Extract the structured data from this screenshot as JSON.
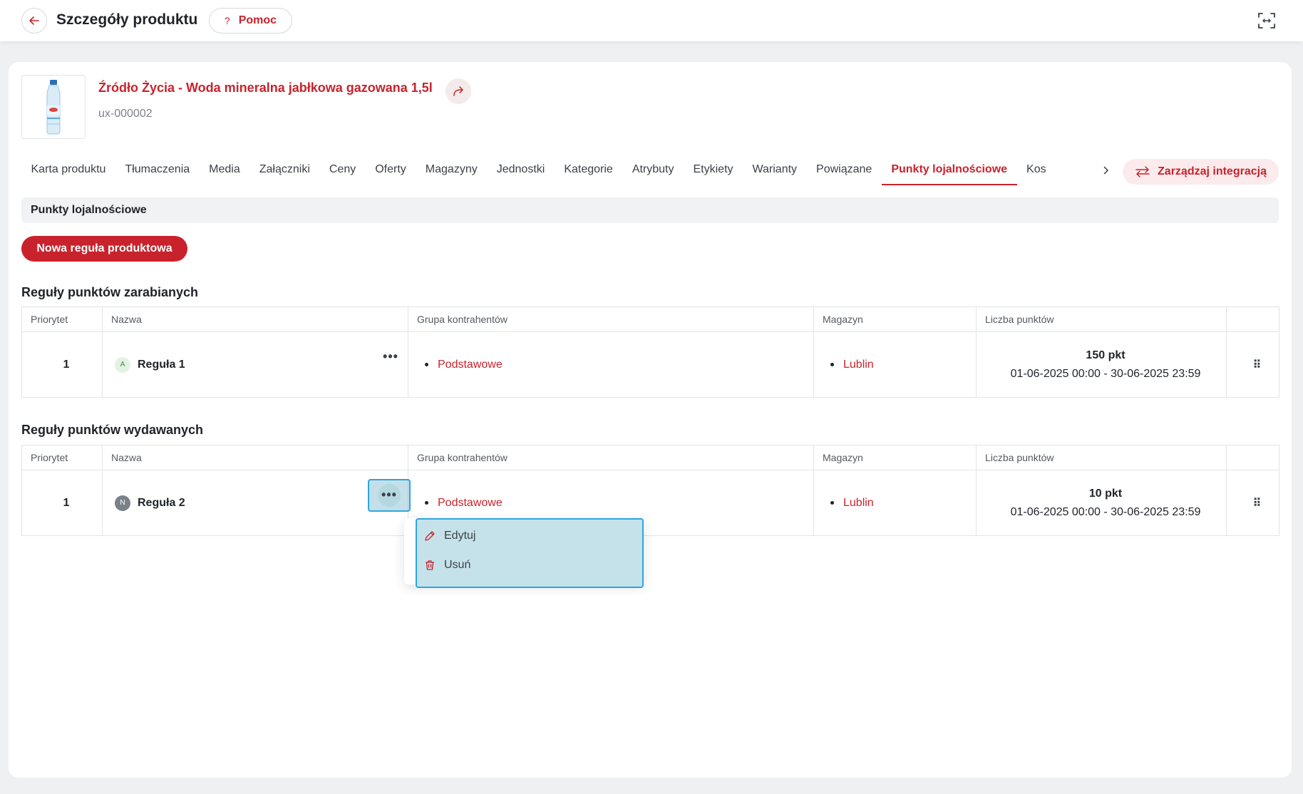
{
  "header": {
    "title": "Szczegóły produktu",
    "help_label": "Pomoc",
    "help_icon": "?"
  },
  "product": {
    "name": "Źródło Życia - Woda mineralna jabłkowa gazowana 1,5l",
    "sku": "ux-000002"
  },
  "tabs": [
    {
      "label": "Karta produktu"
    },
    {
      "label": "Tłumaczenia"
    },
    {
      "label": "Media"
    },
    {
      "label": "Załączniki"
    },
    {
      "label": "Ceny"
    },
    {
      "label": "Oferty"
    },
    {
      "label": "Magazyny"
    },
    {
      "label": "Jednostki"
    },
    {
      "label": "Kategorie"
    },
    {
      "label": "Atrybuty"
    },
    {
      "label": "Etykiety"
    },
    {
      "label": "Warianty"
    },
    {
      "label": "Powiązane"
    },
    {
      "label": "Punkty lojalnościowe",
      "active": true
    },
    {
      "label": "Kos"
    }
  ],
  "integration_button": "Zarządzaj integracją",
  "section_title": "Punkty lojalnościowe",
  "new_rule_button": "Nowa reguła produktowa",
  "columns": {
    "priority": "Priorytet",
    "name": "Nazwa",
    "group": "Grupa kontrahentów",
    "warehouse": "Magazyn",
    "points": "Liczba punktów"
  },
  "earned": {
    "title": "Reguły punktów zarabianych",
    "rows": [
      {
        "priority": "1",
        "avatar": "A",
        "name": "Reguła 1",
        "group": "Podstawowe",
        "warehouse": "Lublin",
        "points": "150 pkt",
        "range": "01-06-2025 00:00 - 30-06-2025 23:59"
      }
    ]
  },
  "spent": {
    "title": "Reguły punktów wydawanych",
    "rows": [
      {
        "priority": "1",
        "avatar": "N",
        "name": "Reguła 2",
        "group": "Podstawowe",
        "warehouse": "Lublin",
        "points": "10 pkt",
        "range": "01-06-2025 00:00 - 30-06-2025 23:59"
      }
    ]
  },
  "context_menu": {
    "edit": "Edytuj",
    "delete": "Usuń"
  },
  "icons": {
    "row_menu": "•••",
    "drag": "⠿"
  },
  "colors": {
    "accent": "#c8232c",
    "highlight": "#2ea6dd"
  }
}
